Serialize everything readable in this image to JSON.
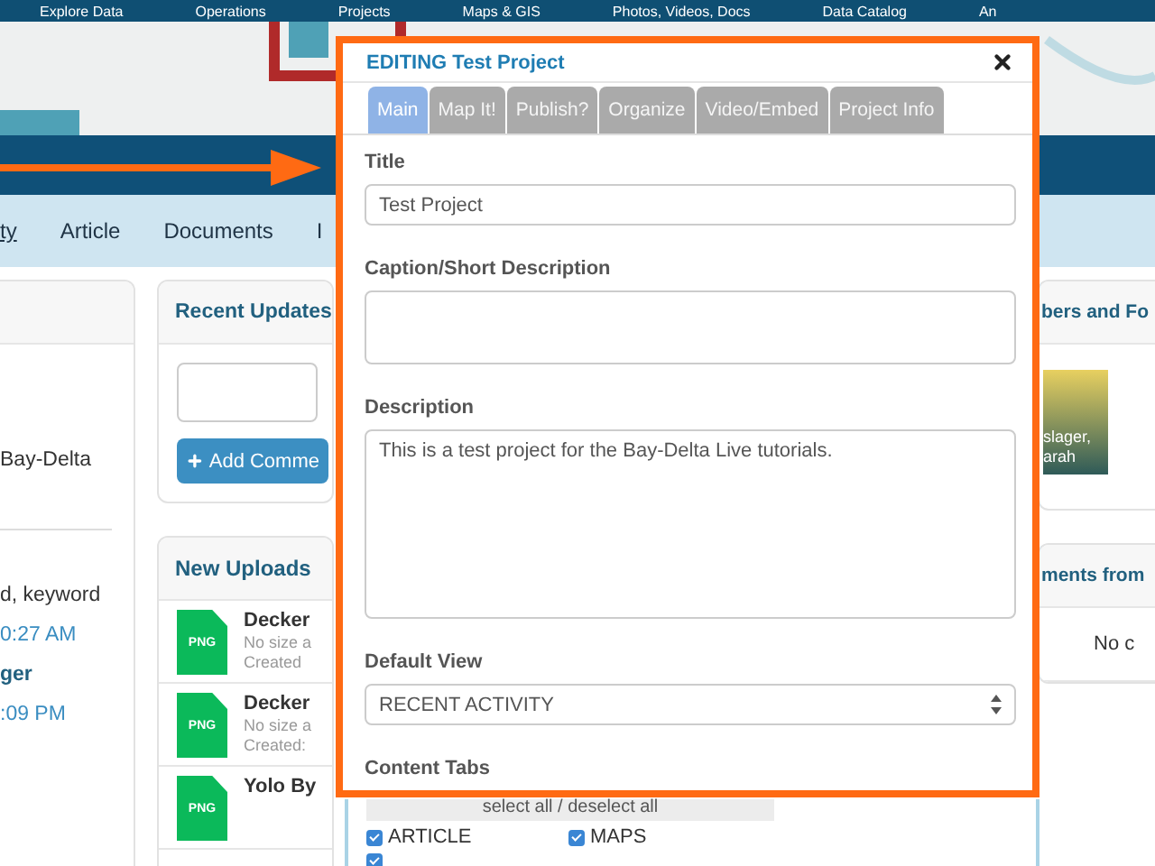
{
  "top_nav": [
    "Explore Data",
    "Operations",
    "Projects",
    "Maps & GIS",
    "Photos, Videos, Docs",
    "Data Catalog",
    "An"
  ],
  "sub_nav": [
    {
      "label": "ty",
      "selected": true
    },
    {
      "label": "Article",
      "selected": false
    },
    {
      "label": "Documents",
      "selected": false
    },
    {
      "label": "I",
      "selected": false
    }
  ],
  "left_panel": {
    "lines": [
      {
        "kind": "text",
        "text": "Bay-Delta"
      },
      {
        "kind": "divider"
      },
      {
        "kind": "text",
        "text": "d, keyword"
      },
      {
        "kind": "time",
        "text": "0:27 AM"
      },
      {
        "kind": "name",
        "text": "ger"
      },
      {
        "kind": "time",
        "text": ":09 PM"
      }
    ]
  },
  "recent_updates": {
    "title": "Recent Updates",
    "button": "Add Comme"
  },
  "new_uploads": {
    "title": "New Uploads",
    "items": [
      {
        "badge": "PNG",
        "name": "Decker",
        "size": "No size a",
        "created": "Created"
      },
      {
        "badge": "PNG",
        "name": "Decker",
        "size": "No size a",
        "created": "Created:"
      },
      {
        "badge": "PNG",
        "name": "Yolo By"
      }
    ]
  },
  "members": {
    "title": "bers and Fo",
    "caption": [
      "slager,",
      "arah"
    ]
  },
  "comments": {
    "title": "ments from",
    "empty": "No c"
  },
  "content_tabs": {
    "select_all": "select all / deselect all",
    "options": [
      {
        "label": "ARTICLE",
        "checked": true
      },
      {
        "label": "MAPS",
        "checked": true
      },
      {
        "checked": true
      }
    ]
  },
  "modal": {
    "title": "EDITING Test Project",
    "tabs": [
      {
        "label": "Main",
        "selected": true
      },
      {
        "label": "Map It!",
        "selected": false
      },
      {
        "label": "Publish?",
        "selected": false
      },
      {
        "label": "Organize",
        "selected": false
      },
      {
        "label": "Video/Embed",
        "selected": false
      },
      {
        "label": "Project Info",
        "selected": false
      }
    ],
    "fields": [
      {
        "kind": "input",
        "label": "Title",
        "value": "Test Project"
      },
      {
        "kind": "smallarea",
        "label": "Caption/Short Description"
      },
      {
        "kind": "textarea",
        "label": "Description",
        "value": "This is a test project for the Bay-Delta Live tutorials."
      },
      {
        "kind": "select",
        "label": "Default View",
        "value": "RECENT ACTIVITY"
      },
      {
        "kind": "heading",
        "label": "Content Tabs"
      }
    ]
  }
}
